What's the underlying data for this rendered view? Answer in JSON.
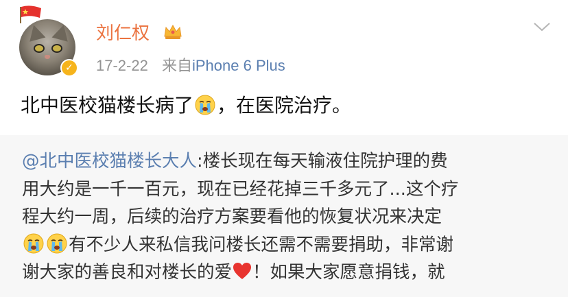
{
  "header": {
    "username": "刘仁权",
    "date": "17-2-22",
    "source_prefix": "来自",
    "source_device": "iPhone 6 Plus"
  },
  "post": {
    "text_before_emoji": "北中医校猫楼长病了",
    "text_after_emoji": "，在医院治疗。"
  },
  "repost": {
    "mention": "@北中医校猫楼长大人",
    "line1_rest": ":楼长现在每天输液住院护理的费",
    "line2": "用大约是一千一百元，现在已经花掉三千多元了...这个疗",
    "line3": "程大约一周，后续的治疗方案要看他的恢复状况来决定",
    "line4_after_emoji": "有不少人来私信我问楼长还需不需要捐助，非常谢",
    "line5_before_heart": "谢大家的善良和对楼长的爱",
    "line5_after_heart": "！如果大家愿意捐钱，就"
  },
  "icons": {
    "flag": "china-flag-icon",
    "crown": "crown-icon",
    "badge": "verified-badge-icon",
    "menu": "chevron-down-icon",
    "cry": "crying-face-emoji-icon",
    "heart": "red-heart-icon"
  },
  "colors": {
    "username": "#eb7340",
    "link": "#5b7fb0",
    "meta": "#939393",
    "repost_bg": "#f7f7f7",
    "badge": "#f6b41c"
  }
}
